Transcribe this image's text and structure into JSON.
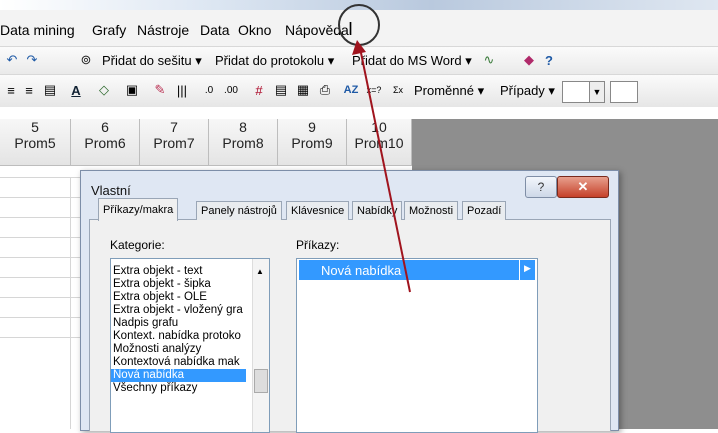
{
  "menubar": {
    "items": [
      "Data mining",
      "Grafy",
      "Nástroje",
      "Data",
      "Okno",
      "Nápověda"
    ]
  },
  "toolbar1": {
    "add_to_workbook": "Přidat do sešitu ▾",
    "add_to_report": "Přidat do protokolu ▾",
    "add_to_word": "Přidat do MS Word ▾"
  },
  "toolbar2": {
    "variables": "Proměnné ▾",
    "cases": "Případy ▾"
  },
  "columns": [
    {
      "num": "5",
      "name": "Prom5"
    },
    {
      "num": "6",
      "name": "Prom6"
    },
    {
      "num": "7",
      "name": "Prom7"
    },
    {
      "num": "8",
      "name": "Prom8"
    },
    {
      "num": "9",
      "name": "Prom9"
    },
    {
      "num": "10",
      "name": "Prom10"
    }
  ],
  "dialog": {
    "title": "Vlastní",
    "help": "?",
    "close": "✕",
    "tabs": [
      "Příkazy/makra",
      "Panely nástrojů",
      "Klávesnice",
      "Nabídky",
      "Možnosti",
      "Pozadí"
    ],
    "categories_label": "Kategorie:",
    "commands_label": "Příkazy:",
    "categories": [
      "Extra objekt - text",
      "Extra objekt - šipka",
      "Extra objekt - OLE",
      "Extra objekt - vložený gra",
      "Nadpis grafu",
      "Kontext. nabídka protoko",
      "Možnosti analýzy",
      "Kontextová nabídka mak",
      "Nová nabídka",
      "Všechny příkazy"
    ],
    "selected_category_index": 8,
    "command_selected": "Nová nabídka"
  },
  "colors": {
    "selection": "#3399ff",
    "arrow": "#a0141e",
    "dialog_bg": "#dfe7f3"
  }
}
